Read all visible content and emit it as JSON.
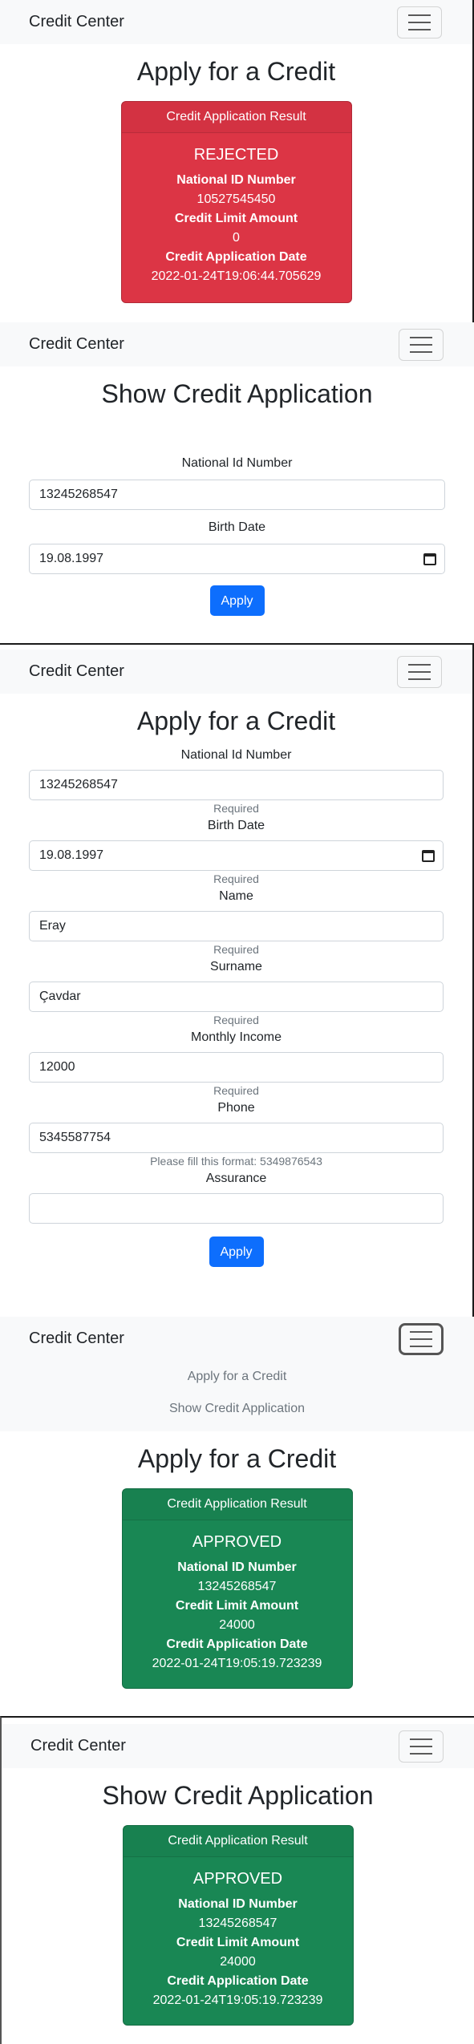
{
  "brand": "Credit Center",
  "panels": {
    "p1": {
      "title": "Apply for a Credit",
      "card": {
        "header": "Credit Application Result",
        "status": "REJECTED",
        "label_id": "National ID Number",
        "value_id": "10527545450",
        "label_limit": "Credit Limit Amount",
        "value_limit": "0",
        "label_date": "Credit Application Date",
        "value_date": "2022-01-24T19:06:44.705629"
      }
    },
    "p2": {
      "title": "Show Credit Application",
      "label_id": "National Id Number",
      "value_id": "13245268547",
      "label_birth": "Birth Date",
      "value_birth": "19.08.1997",
      "button": "Apply"
    },
    "p3": {
      "title": "Apply for a Credit",
      "label_id": "National Id Number",
      "value_id": "13245268547",
      "hint_id": "Required",
      "label_birth": "Birth Date",
      "value_birth": "19.08.1997",
      "hint_birth": "Required",
      "label_name": "Name",
      "value_name": "Eray",
      "hint_name": "Required",
      "label_surname": "Surname",
      "value_surname": "Çavdar",
      "hint_surname": "Required",
      "label_income": "Monthly Income",
      "value_income": "12000",
      "hint_income": "Required",
      "label_phone": "Phone",
      "value_phone": "5345587754",
      "hint_phone": "Please fill this format: 5349876543",
      "label_assurance": "Assurance",
      "value_assurance": "",
      "button": "Apply"
    },
    "p4": {
      "menu": [
        "Apply for a Credit",
        "Show Credit Application"
      ],
      "title": "Apply for a Credit",
      "card": {
        "header": "Credit Application Result",
        "status": "APPROVED",
        "label_id": "National ID Number",
        "value_id": "13245268547",
        "label_limit": "Credit Limit Amount",
        "value_limit": "24000",
        "label_date": "Credit Application Date",
        "value_date": "2022-01-24T19:05:19.723239"
      }
    },
    "p5": {
      "title": "Show Credit Application",
      "card": {
        "header": "Credit Application Result",
        "status": "APPROVED",
        "label_id": "National ID Number",
        "value_id": "13245268547",
        "label_limit": "Credit Limit Amount",
        "value_limit": "24000",
        "label_date": "Credit Application Date",
        "value_date": "2022-01-24T19:05:19.723239"
      }
    }
  },
  "colors": {
    "rejected": "#dc3545",
    "approved": "#198754",
    "primary": "#0d6efd",
    "navbar": "#f8f9fa"
  },
  "icons": [
    "hamburger-menu-icon",
    "calendar-icon"
  ]
}
